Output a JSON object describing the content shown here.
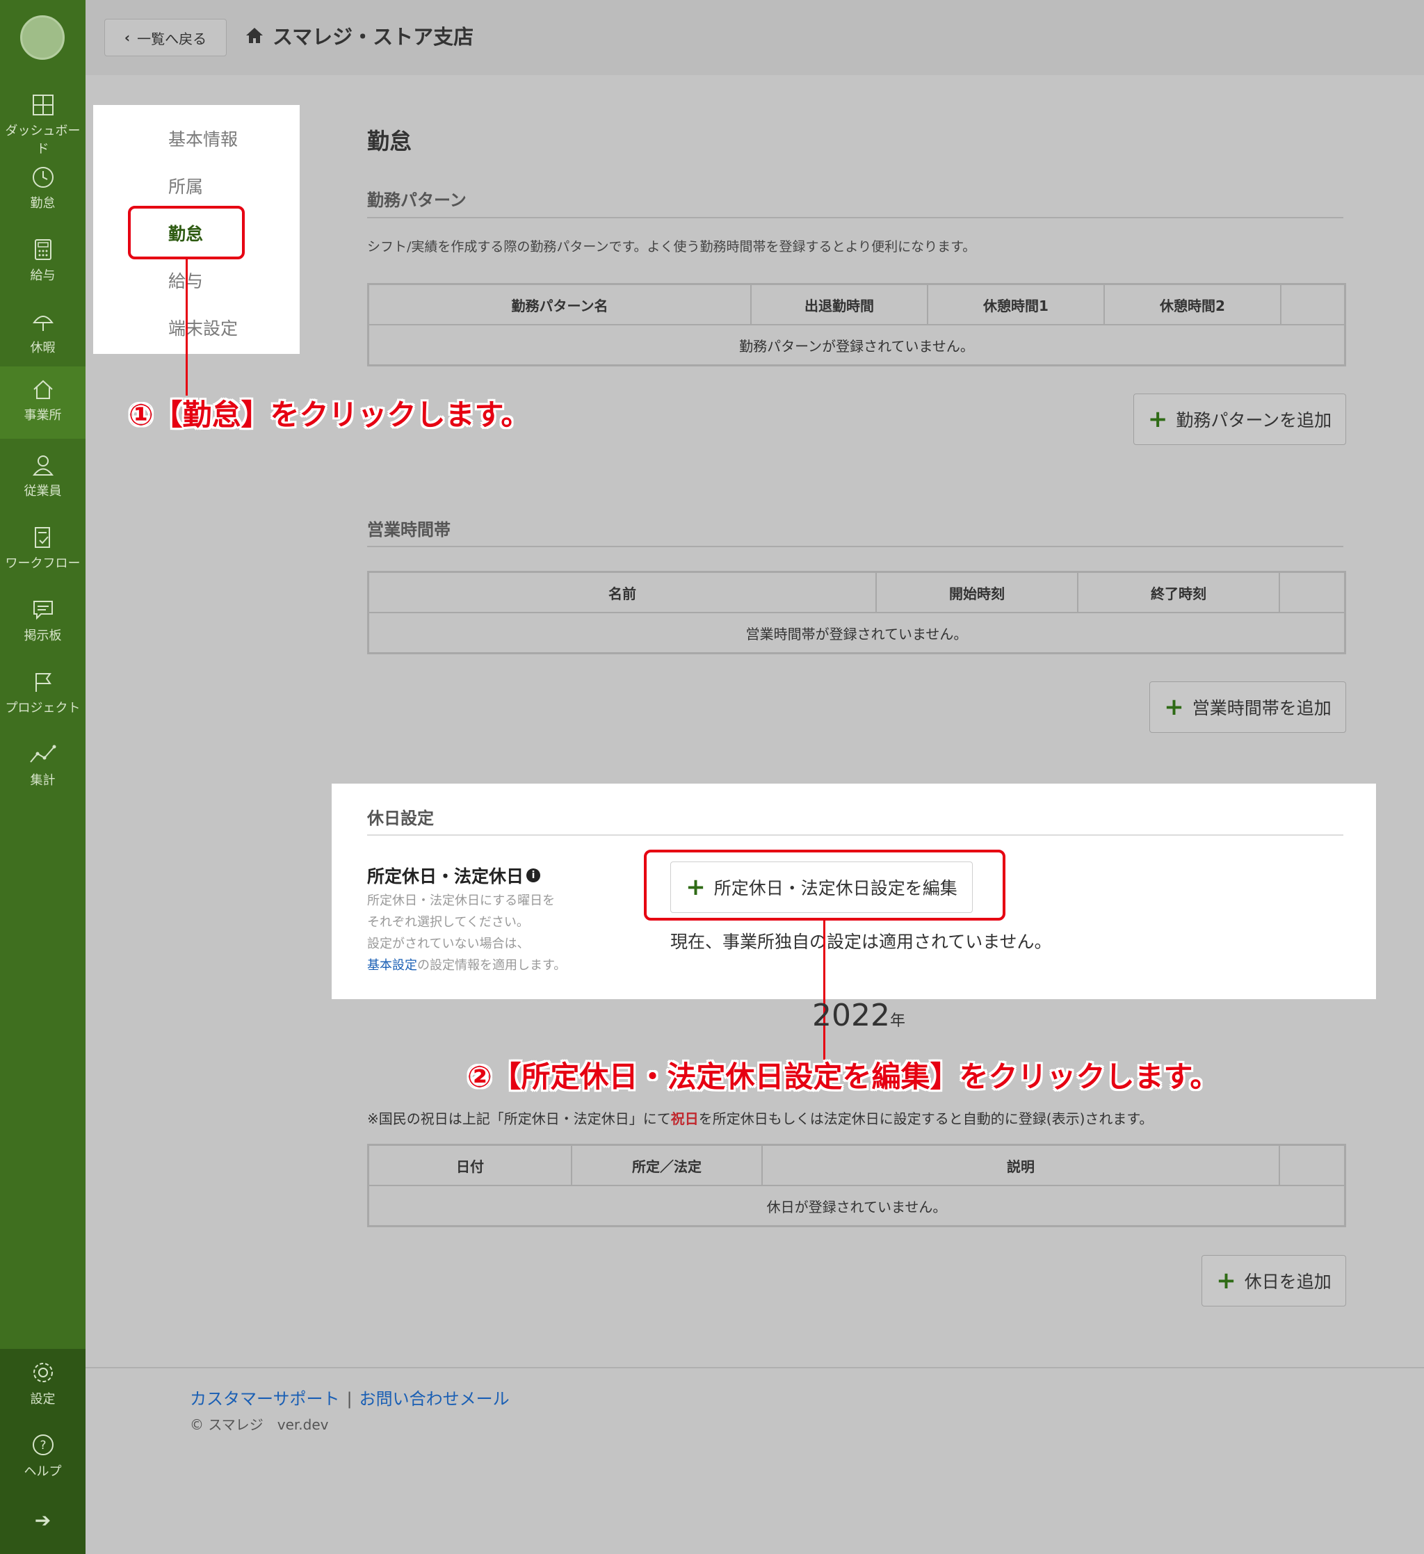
{
  "header": {
    "back_label": "一覧へ戻る",
    "store_name": "スマレジ・ストア支店"
  },
  "sidebar": {
    "items": [
      {
        "label": "ダッシュボード",
        "icon": "dashboard-icon"
      },
      {
        "label": "勤怠",
        "icon": "clock-icon"
      },
      {
        "label": "給与",
        "icon": "calculator-icon"
      },
      {
        "label": "休暇",
        "icon": "umbrella-icon"
      },
      {
        "label": "事業所",
        "icon": "home-icon"
      },
      {
        "label": "従業員",
        "icon": "person-icon"
      },
      {
        "label": "ワークフロー",
        "icon": "document-check-icon"
      },
      {
        "label": "掲示板",
        "icon": "chat-icon"
      },
      {
        "label": "プロジェクト",
        "icon": "flag-icon"
      },
      {
        "label": "集計",
        "icon": "line-chart-icon"
      }
    ],
    "bottom": [
      {
        "label": "設定",
        "icon": "gear-icon"
      },
      {
        "label": "ヘルプ",
        "icon": "help-icon"
      }
    ],
    "active_index": 4
  },
  "subnav": {
    "items": [
      "基本情報",
      "所属",
      "勤怠",
      "給与",
      "端末設定"
    ],
    "active": "勤怠"
  },
  "annotations": {
    "step1": "①【勤怠】をクリックします。",
    "step2": "②【所定休日・法定休日設定を編集】をクリックします。"
  },
  "page": {
    "title": "勤怠",
    "work_pattern": {
      "title": "勤務パターン",
      "description": "シフト/実績を作成する際の勤務パターンです。よく使う勤務時間帯を登録するとより便利になります。",
      "columns": [
        "勤務パターン名",
        "出退勤時間",
        "休憩時間1",
        "休憩時間2",
        ""
      ],
      "empty": "勤務パターンが登録されていません。",
      "add_label": "勤務パターンを追加"
    },
    "business_hours": {
      "title": "営業時間帯",
      "columns": [
        "名前",
        "開始時刻",
        "終了時刻",
        ""
      ],
      "empty": "営業時間帯が登録されていません。",
      "add_label": "営業時間帯を追加"
    },
    "holiday": {
      "title": "休日設定",
      "label": "所定休日・法定休日",
      "notes": [
        "所定休日・法定休日にする曜日を",
        "それぞれ選択してください。",
        "設定がされていない場合は、"
      ],
      "link": "基本設定",
      "link_suffix": "の設定情報を適用します。",
      "edit_label": "所定休日・法定休日設定を編集",
      "status": "現在、事業所独自の設定は適用されていません。"
    },
    "year": "2022",
    "year_suffix": "年",
    "note_prefix": "※国民の祝日は上記「所定休日・法定休日」にて",
    "note_red": "祝日",
    "note_suffix": "を所定休日もしくは法定休日に設定すると自動的に登録(表示)されます。",
    "holidays_table": {
      "columns": [
        "日付",
        "所定／法定",
        "説明",
        ""
      ],
      "empty": "休日が登録されていません。",
      "add_label": "休日を追加"
    }
  },
  "footer": {
    "support": "カスタマーサポート",
    "separator": "|",
    "mail": "お問い合わせメール",
    "copyright": "© スマレジ　ver.dev"
  }
}
